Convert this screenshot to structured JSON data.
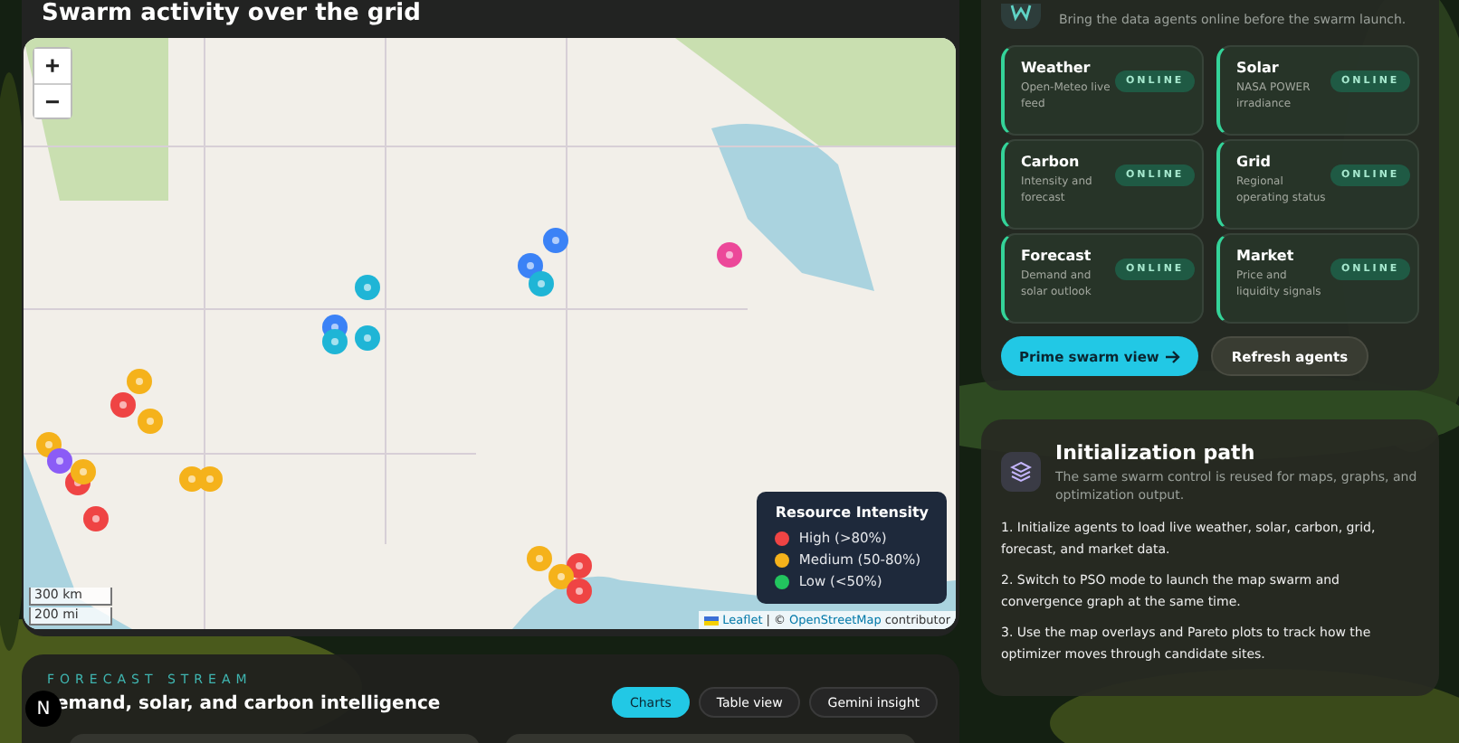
{
  "map_section": {
    "title": "Swarm activity over the grid",
    "zoom": [
      "+",
      "−"
    ],
    "scale": [
      "300 km",
      "200 mi"
    ],
    "attribution": {
      "leaflet": "Leaflet",
      "separator": "| ©",
      "osm": "OpenStreetMap",
      "rest": "contributor"
    },
    "legend": {
      "title": "Resource Intensity",
      "items": [
        {
          "label": "High (>80%)",
          "color": "#ef4444"
        },
        {
          "label": "Medium (50-80%)",
          "color": "#f5b21b"
        },
        {
          "label": "Low (<50%)",
          "color": "#22c55e"
        }
      ]
    }
  },
  "forecast": {
    "eyebrow": "FORECAST STREAM",
    "title": "emand, solar, and carbon intelligence",
    "badge": "N",
    "tabs": [
      {
        "label": "Charts",
        "selected": true
      },
      {
        "label": "Table view",
        "selected": false
      },
      {
        "label": "Gemini insight",
        "selected": false
      }
    ]
  },
  "agents": {
    "subtitle": "Bring the data agents online before the swarm launch.",
    "items": [
      {
        "name": "Weather",
        "description": "Open-Meteo live feed",
        "status": "ONLINE",
        "online": true
      },
      {
        "name": "Solar",
        "description": "NASA POWER irradiance",
        "status": "ONLINE",
        "online": true
      },
      {
        "name": "Carbon",
        "description": "Intensity and forecast",
        "status": "ONLINE",
        "online": true
      },
      {
        "name": "Grid",
        "description": "Regional operating status",
        "status": "ONLINE",
        "online": true
      },
      {
        "name": "Forecast",
        "description": "Demand and solar outlook",
        "status": "ONLINE",
        "online": true
      },
      {
        "name": "Market",
        "description": "Price and liquidity signals",
        "status": "ONLINE",
        "online": true
      }
    ],
    "primary": "Prime swarm view",
    "secondary": "Refresh agents"
  },
  "init_path": {
    "title": "Initialization path",
    "subtitle": "The same swarm control is reused for maps, graphs, and optimization output.",
    "steps": [
      "1. Initialize agents to load live weather, solar, carbon, grid, forecast, and market data.",
      "2. Switch to PSO mode to launch the map swarm and convergence graph at the same time.",
      "3. Use the map overlays and Pareto plots to track how the optimizer moves through candidate sites."
    ]
  }
}
